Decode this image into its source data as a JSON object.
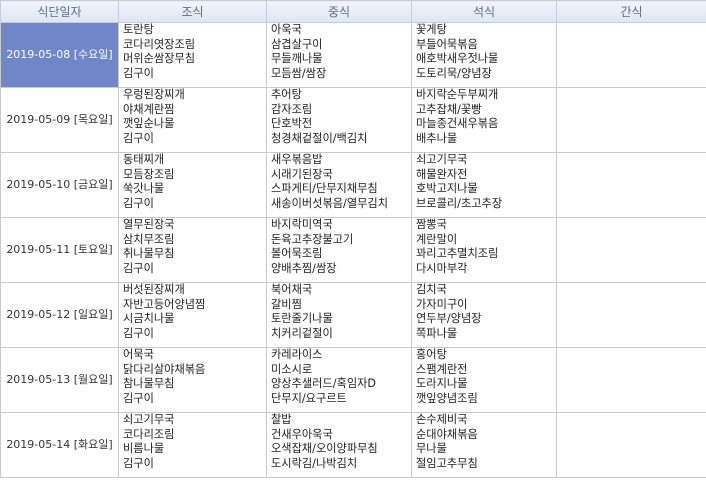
{
  "headers": [
    "식단일자",
    "조식",
    "중식",
    "석식",
    "간식"
  ],
  "rows": [
    {
      "date": "2019-05-08 [수요일]",
      "breakfast": [
        "토란탕",
        "코다리엿장조림",
        "머위순쌈장무침",
        "김구이"
      ],
      "lunch": [
        "아욱국",
        "삼겹살구이",
        "무들깨나물",
        "모듬쌈/쌈장"
      ],
      "dinner": [
        "꽃게탕",
        "부들어묵볶음",
        "애호박새우젓나물",
        "도토리묵/양념장"
      ],
      "snack": []
    },
    {
      "date": "2019-05-09 [목요일]",
      "breakfast": [
        "우렁된장찌개",
        "야채계란찜",
        "깻잎순나물",
        "김구이"
      ],
      "lunch": [
        "추어탕",
        "감자조림",
        "단호박전",
        "청경채겉절이/백김치"
      ],
      "dinner": [
        "바지락순두부찌개",
        "고추잡채/꽃빵",
        "마늘종건새우볶음",
        "배추나물"
      ],
      "snack": []
    },
    {
      "date": "2019-05-10 [금요일]",
      "breakfast": [
        "동태찌개",
        "모듬장조림",
        "쑥갓나물",
        "김구이"
      ],
      "lunch": [
        "새우볶음밥",
        "시래기된장국",
        "스파게티/단무지채무침",
        "새송이버섯볶음/열무김치"
      ],
      "dinner": [
        "쇠고기무국",
        "해물완자전",
        "호박고지나물",
        "브로콜리/초고추장"
      ],
      "snack": []
    },
    {
      "date": "2019-05-11 [토요일]",
      "breakfast": [
        "열무된장국",
        "삼치무조림",
        "취나물무침",
        "김구이"
      ],
      "lunch": [
        "바지락미역국",
        "돈육고추장불고기",
        "볼어묵조림",
        "양배추찜/쌈장"
      ],
      "dinner": [
        "짬뽕국",
        "계란말이",
        "꽈리고추멸치조림",
        "다시마부각"
      ],
      "snack": []
    },
    {
      "date": "2019-05-12 [일요일]",
      "breakfast": [
        "버섯된장찌개",
        "자반고등어양념찜",
        "시금치나물",
        "김구이"
      ],
      "lunch": [
        "북어채국",
        "갈비찜",
        "토란줄기나물",
        "치커리겉절이"
      ],
      "dinner": [
        "김치국",
        "가자미구이",
        "연두부/양념장",
        "쪽파나물"
      ],
      "snack": []
    },
    {
      "date": "2019-05-13 [월요일]",
      "breakfast": [
        "어묵국",
        "닭다리살야채볶음",
        "참나물무침",
        "김구이"
      ],
      "lunch": [
        "카레라이스",
        "미소시로",
        "양상추샐러드/혹임자D",
        "단무지/요구르트"
      ],
      "dinner": [
        "홍어탕",
        "스팸계란전",
        "도라지나물",
        "깻잎양념조림"
      ],
      "snack": []
    },
    {
      "date": "2019-05-14 [화요일]",
      "breakfast": [
        "쇠고기무국",
        "코다리조림",
        "비름나물",
        "김구이"
      ],
      "lunch": [
        "찰밥",
        "건새우아욱국",
        "오색잡채/오이양파무침",
        "도시락김/나박김치"
      ],
      "dinner": [
        "손수제비국",
        "순대야채볶음",
        "무나물",
        "절임고추무침"
      ],
      "snack": []
    }
  ],
  "colors": {
    "header_text": "#5a6f8c",
    "selected_bg": "#6f87c9"
  }
}
